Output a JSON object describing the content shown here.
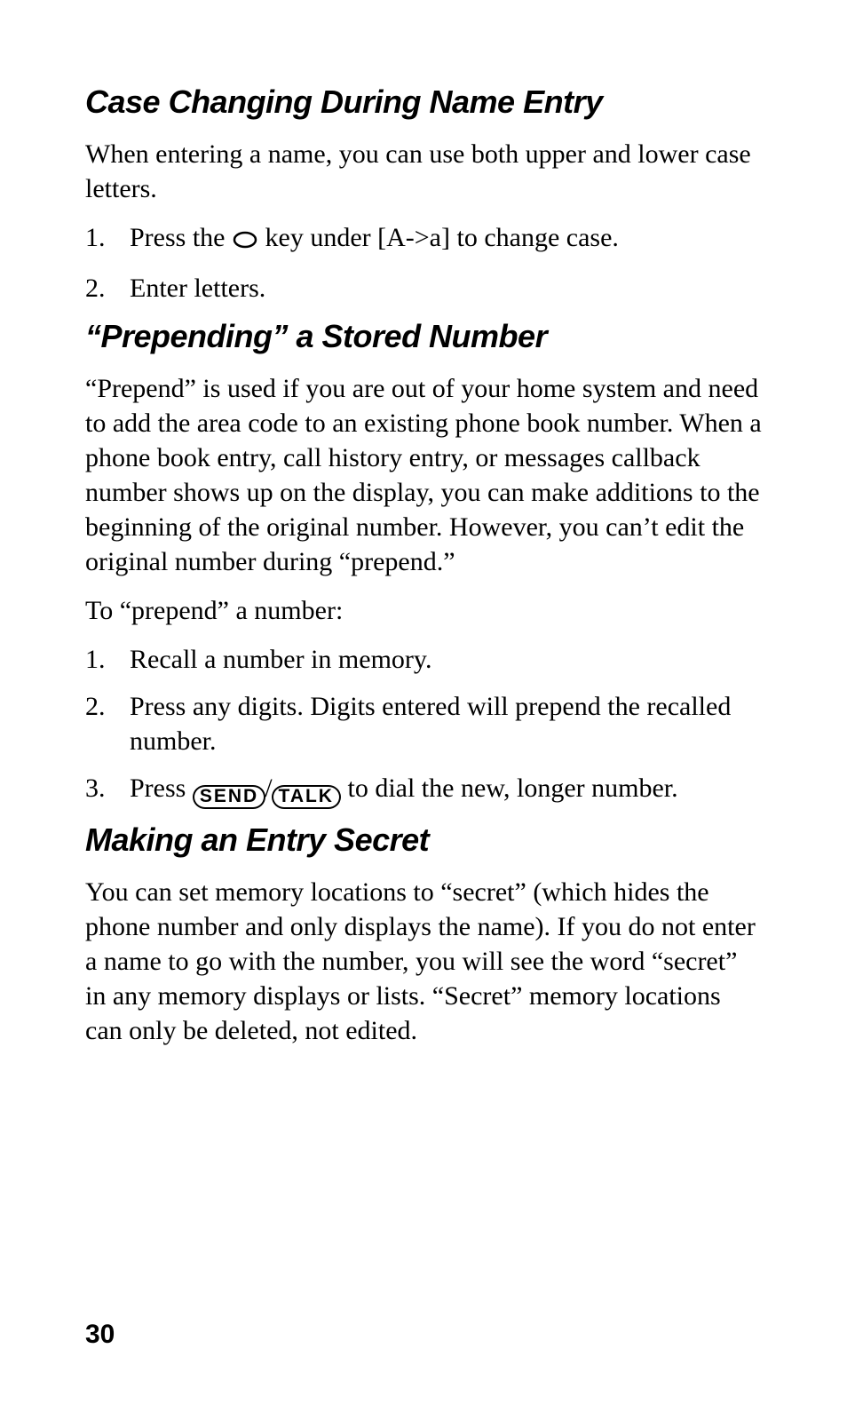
{
  "section1": {
    "heading": "Case Changing During Name Entry",
    "intro": "When entering a name, you can use both upper and lower case letters.",
    "steps": {
      "s1_before": "Press the ",
      "s1_after": " key under [A->a] to change case.",
      "s2": "Enter letters."
    }
  },
  "section2": {
    "heading": "“Prepending” a Stored Number",
    "p1": "“Prepend” is used if you are out of your home system and need to add the area code to an existing phone book number. When a phone book entry, call history entry, or messages callback number shows up on the display, you can make additions to the beginning of the original number. However, you can’t edit the original number during “prepend.”",
    "p2": "To “prepend” a number:",
    "steps": {
      "s1": "Recall a number in memory.",
      "s2": "Press any digits. Digits entered will prepend the recalled number.",
      "s3_before": "Press ",
      "s3_after": " to dial the new, longer number."
    }
  },
  "section3": {
    "heading": "Making an Entry Secret",
    "p1": "You can set memory locations to “secret” (which hides the phone number and only displays the name). If you do not enter a name to go with the number, you will see the word “secret” in any memory displays or lists. “Secret” memory locations can only be deleted, not edited."
  },
  "keys": {
    "send": "SEND",
    "talk": "TALK"
  },
  "pageNumber": "30"
}
